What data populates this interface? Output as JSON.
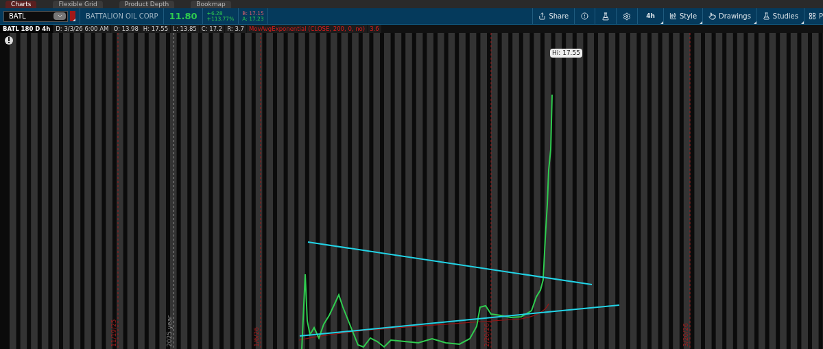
{
  "top_tabs": [
    {
      "label": "Charts",
      "selected": true
    },
    {
      "label": "Flexible Grid",
      "selected": false
    },
    {
      "label": "Product Depth",
      "selected": false
    },
    {
      "label": "Bookmap",
      "selected": false
    }
  ],
  "header": {
    "symbol": "BATL",
    "company": "BATTALION OIL CORP",
    "last": "11.80",
    "change": "+6.28",
    "change_pct": "+113.77%",
    "bid": "B: 17.15",
    "ask": "A: 17.23"
  },
  "toolbar": {
    "share": "Share",
    "timeframe": "4h",
    "style": "Style",
    "drawings": "Drawings",
    "studies": "Studies",
    "cut_item": "P"
  },
  "info_bar": {
    "title": "BATL 180 D 4h",
    "fields": [
      "D: 3/3/26 6:00 AM",
      "O: 13.98",
      "H: 17.55",
      "L: 13.85",
      "C: 17.2",
      "R: 3.7"
    ],
    "study": "MovAvgExponential (CLOSE, 200, 0, no)",
    "study_value": "3.6"
  },
  "chart": {
    "high_label": "Hi: 17.55",
    "date_markers": [
      {
        "label": "11/19/25",
        "kind": "month"
      },
      {
        "label": "2025 year",
        "kind": "year"
      },
      {
        "label": "1/6/26",
        "kind": "month"
      },
      {
        "label": "2/20/26",
        "kind": "month"
      },
      {
        "label": "3/20/26",
        "kind": "month"
      }
    ]
  }
}
